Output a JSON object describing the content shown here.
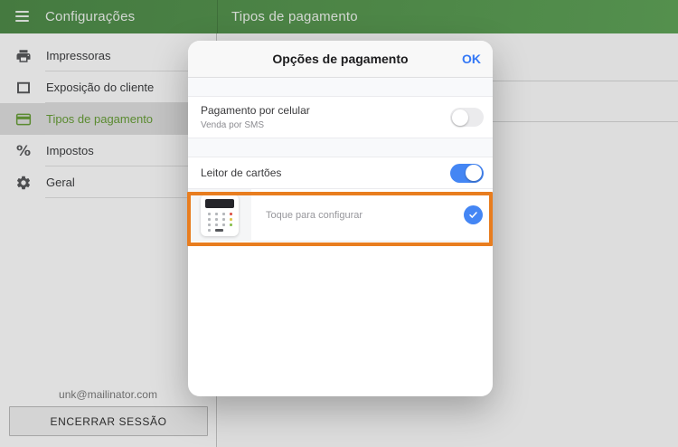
{
  "header": {
    "nav_title": "Configurações",
    "page_title": "Tipos de pagamento"
  },
  "sidebar": {
    "items": [
      {
        "label": "Impressoras",
        "icon": "printer-icon",
        "selected": false
      },
      {
        "label": "Exposição do cliente",
        "icon": "display-icon",
        "selected": false
      },
      {
        "label": "Tipos de pagamento",
        "icon": "card-icon",
        "selected": true
      },
      {
        "label": "Impostos",
        "icon": "percent-icon",
        "selected": false
      },
      {
        "label": "Geral",
        "icon": "gear-icon",
        "selected": false
      }
    ],
    "account_email": "unk@mailinator.com",
    "logout_label": "ENCERRAR SESSÃO"
  },
  "modal": {
    "title": "Opções de pagamento",
    "ok_label": "OK",
    "mobile_payment": {
      "title": "Pagamento por celular",
      "subtitle": "Venda por SMS",
      "enabled": false
    },
    "card_reader": {
      "title": "Leitor de cartões",
      "enabled": true,
      "device_hint": "Toque para configurar",
      "device_selected": true
    }
  },
  "icons": {
    "percent_glyph": "%"
  },
  "colors": {
    "header_green": "#579750",
    "selected_green": "#689f38",
    "toggle_blue": "#4486f4",
    "ok_blue": "#3478f6",
    "highlight_orange": "#e87d1f"
  }
}
